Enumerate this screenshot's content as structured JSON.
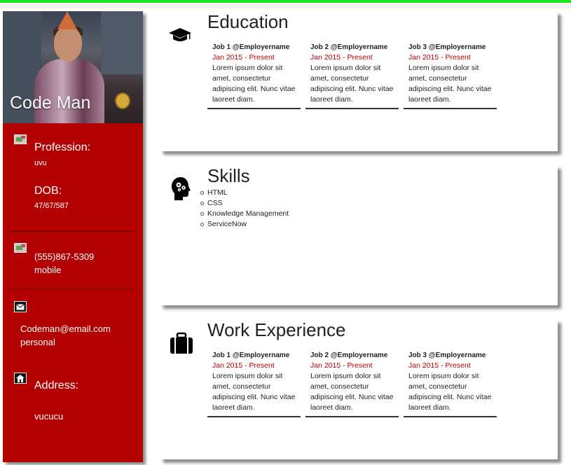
{
  "colors": {
    "accent": "#b30000",
    "topbar": "#19e61e"
  },
  "sidebar": {
    "name": "Code Man",
    "profession_label": "Profession:",
    "profession_value": "uvu",
    "dob_label": "DOB:",
    "dob_value": "47/67/587",
    "phone_number": "(555)867-5309",
    "phone_type": "mobile",
    "email_address": "Codeman@email.com",
    "email_type": "personal",
    "address_label": "Address:",
    "address_value": "vucucu"
  },
  "education": {
    "title": "Education",
    "icon": "graduation-cap-icon",
    "jobs": [
      {
        "title": "Job 1 @Employername",
        "date": "Jan 2015 - Present",
        "desc": "Lorem ipsum dolor sit amet, consectetur adipiscing elit. Nunc vitae laoreet diam."
      },
      {
        "title": "Job 2 @Employername",
        "date": "Jan 2015 - Present",
        "desc": "Lorem ipsum dolor sit amet, consectetur adipiscing elit. Nunc vitae laoreet diam."
      },
      {
        "title": "Job 3 @Employername",
        "date": "Jan 2015 - Present",
        "desc": "Lorem ipsum dolor sit amet, consectetur adipiscing elit. Nunc vitae laoreet diam."
      }
    ]
  },
  "skills": {
    "title": "Skills",
    "icon": "head-gears-icon",
    "items": [
      "HTML",
      "CSS",
      "Knowledge Management",
      "ServiceNow"
    ]
  },
  "work": {
    "title": "Work Experience",
    "icon": "briefcase-icon",
    "jobs": [
      {
        "title": "Job 1 @Employername",
        "date": "Jan 2015 - Present",
        "desc": "Lorem ipsum dolor sit amet, consectetur adipiscing elit. Nunc vitae laoreet diam."
      },
      {
        "title": "Job 2 @Employername",
        "date": "Jan 2015 - Present",
        "desc": "Lorem ipsum dolor sit amet, consectetur adipiscing elit. Nunc vitae laoreet diam."
      },
      {
        "title": "Job 3 @Employername",
        "date": "Jan 2015 - Present",
        "desc": "Lorem ipsum dolor sit amet, consectetur adipiscing elit. Nunc vitae laoreet diam."
      }
    ]
  }
}
